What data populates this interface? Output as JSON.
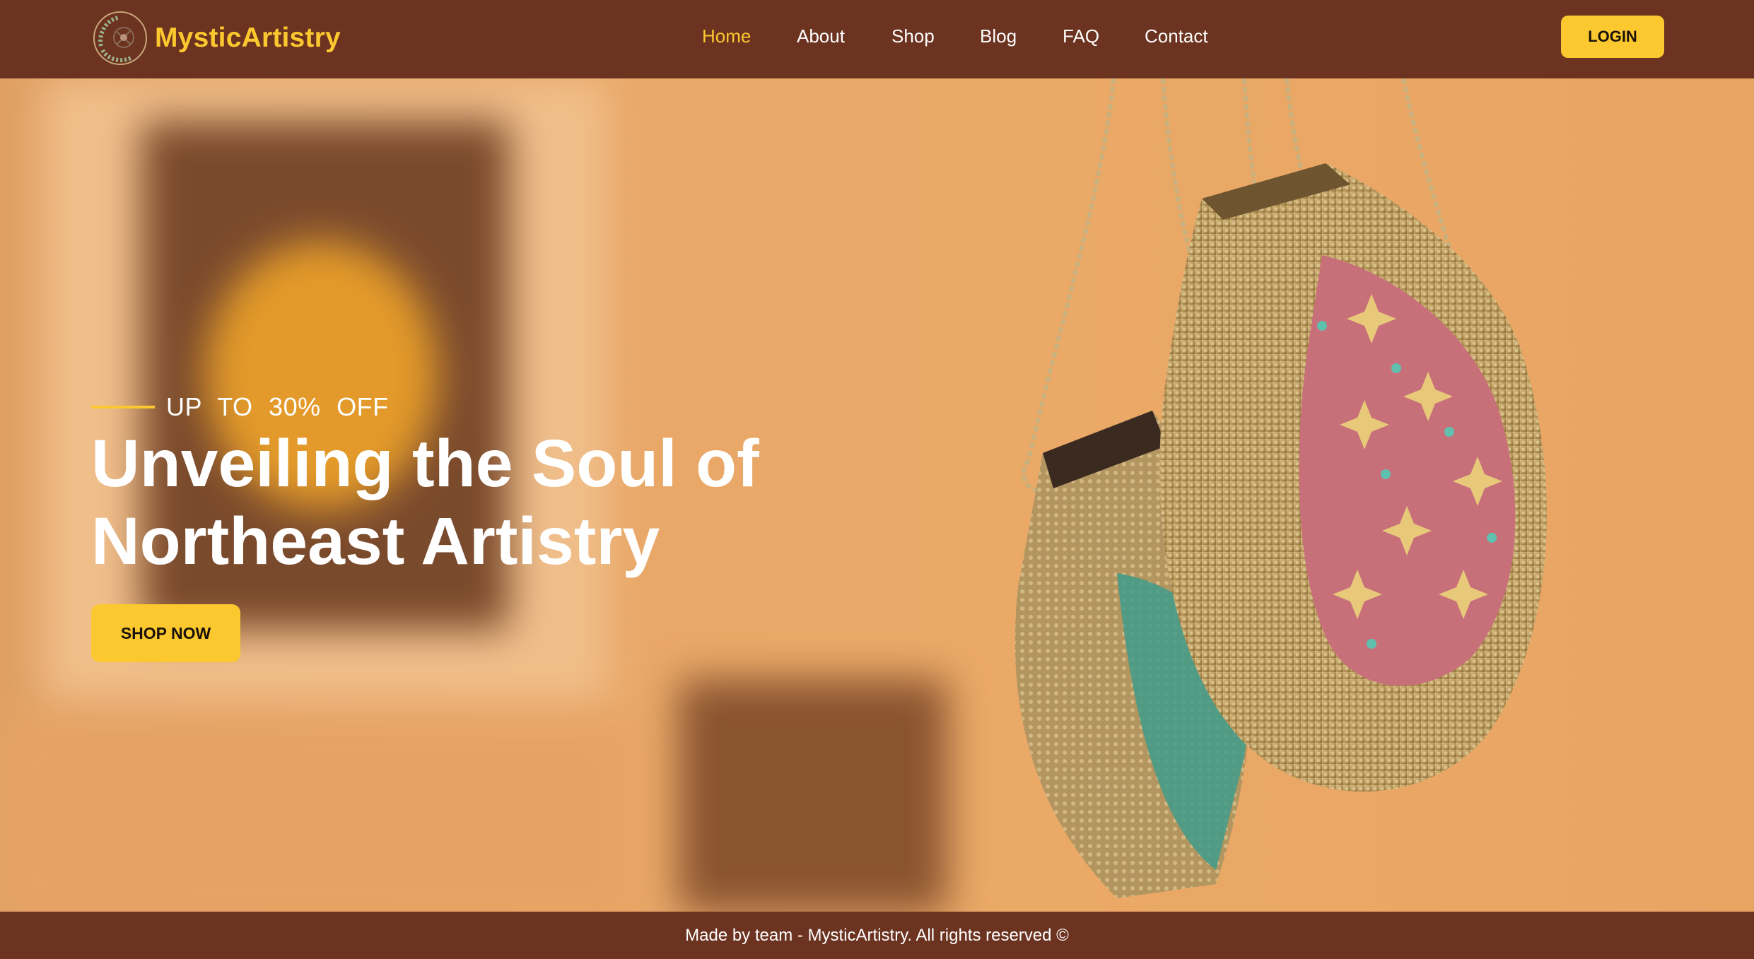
{
  "brand": {
    "name": "MysticArtistry",
    "logo_icon": "mandala-wreath-icon"
  },
  "nav": {
    "items": [
      {
        "label": "Home",
        "active": true
      },
      {
        "label": "About",
        "active": false
      },
      {
        "label": "Shop",
        "active": false
      },
      {
        "label": "Blog",
        "active": false
      },
      {
        "label": "FAQ",
        "active": false
      },
      {
        "label": "Contact",
        "active": false
      }
    ],
    "login_label": "LOGIN"
  },
  "hero": {
    "offer": "UP TO 30% OFF",
    "headline_line1": "Unveiling the Soul of",
    "headline_line2": "Northeast Artistry",
    "cta_label": "SHOP NOW"
  },
  "footer": {
    "text": "Made by team - MysticArtistry. All rights reserved ©"
  },
  "colors": {
    "header_bg": "#6b3320",
    "accent": "#fcc82f",
    "hero_bg": "#e9a869",
    "text_light": "#ffffff"
  }
}
